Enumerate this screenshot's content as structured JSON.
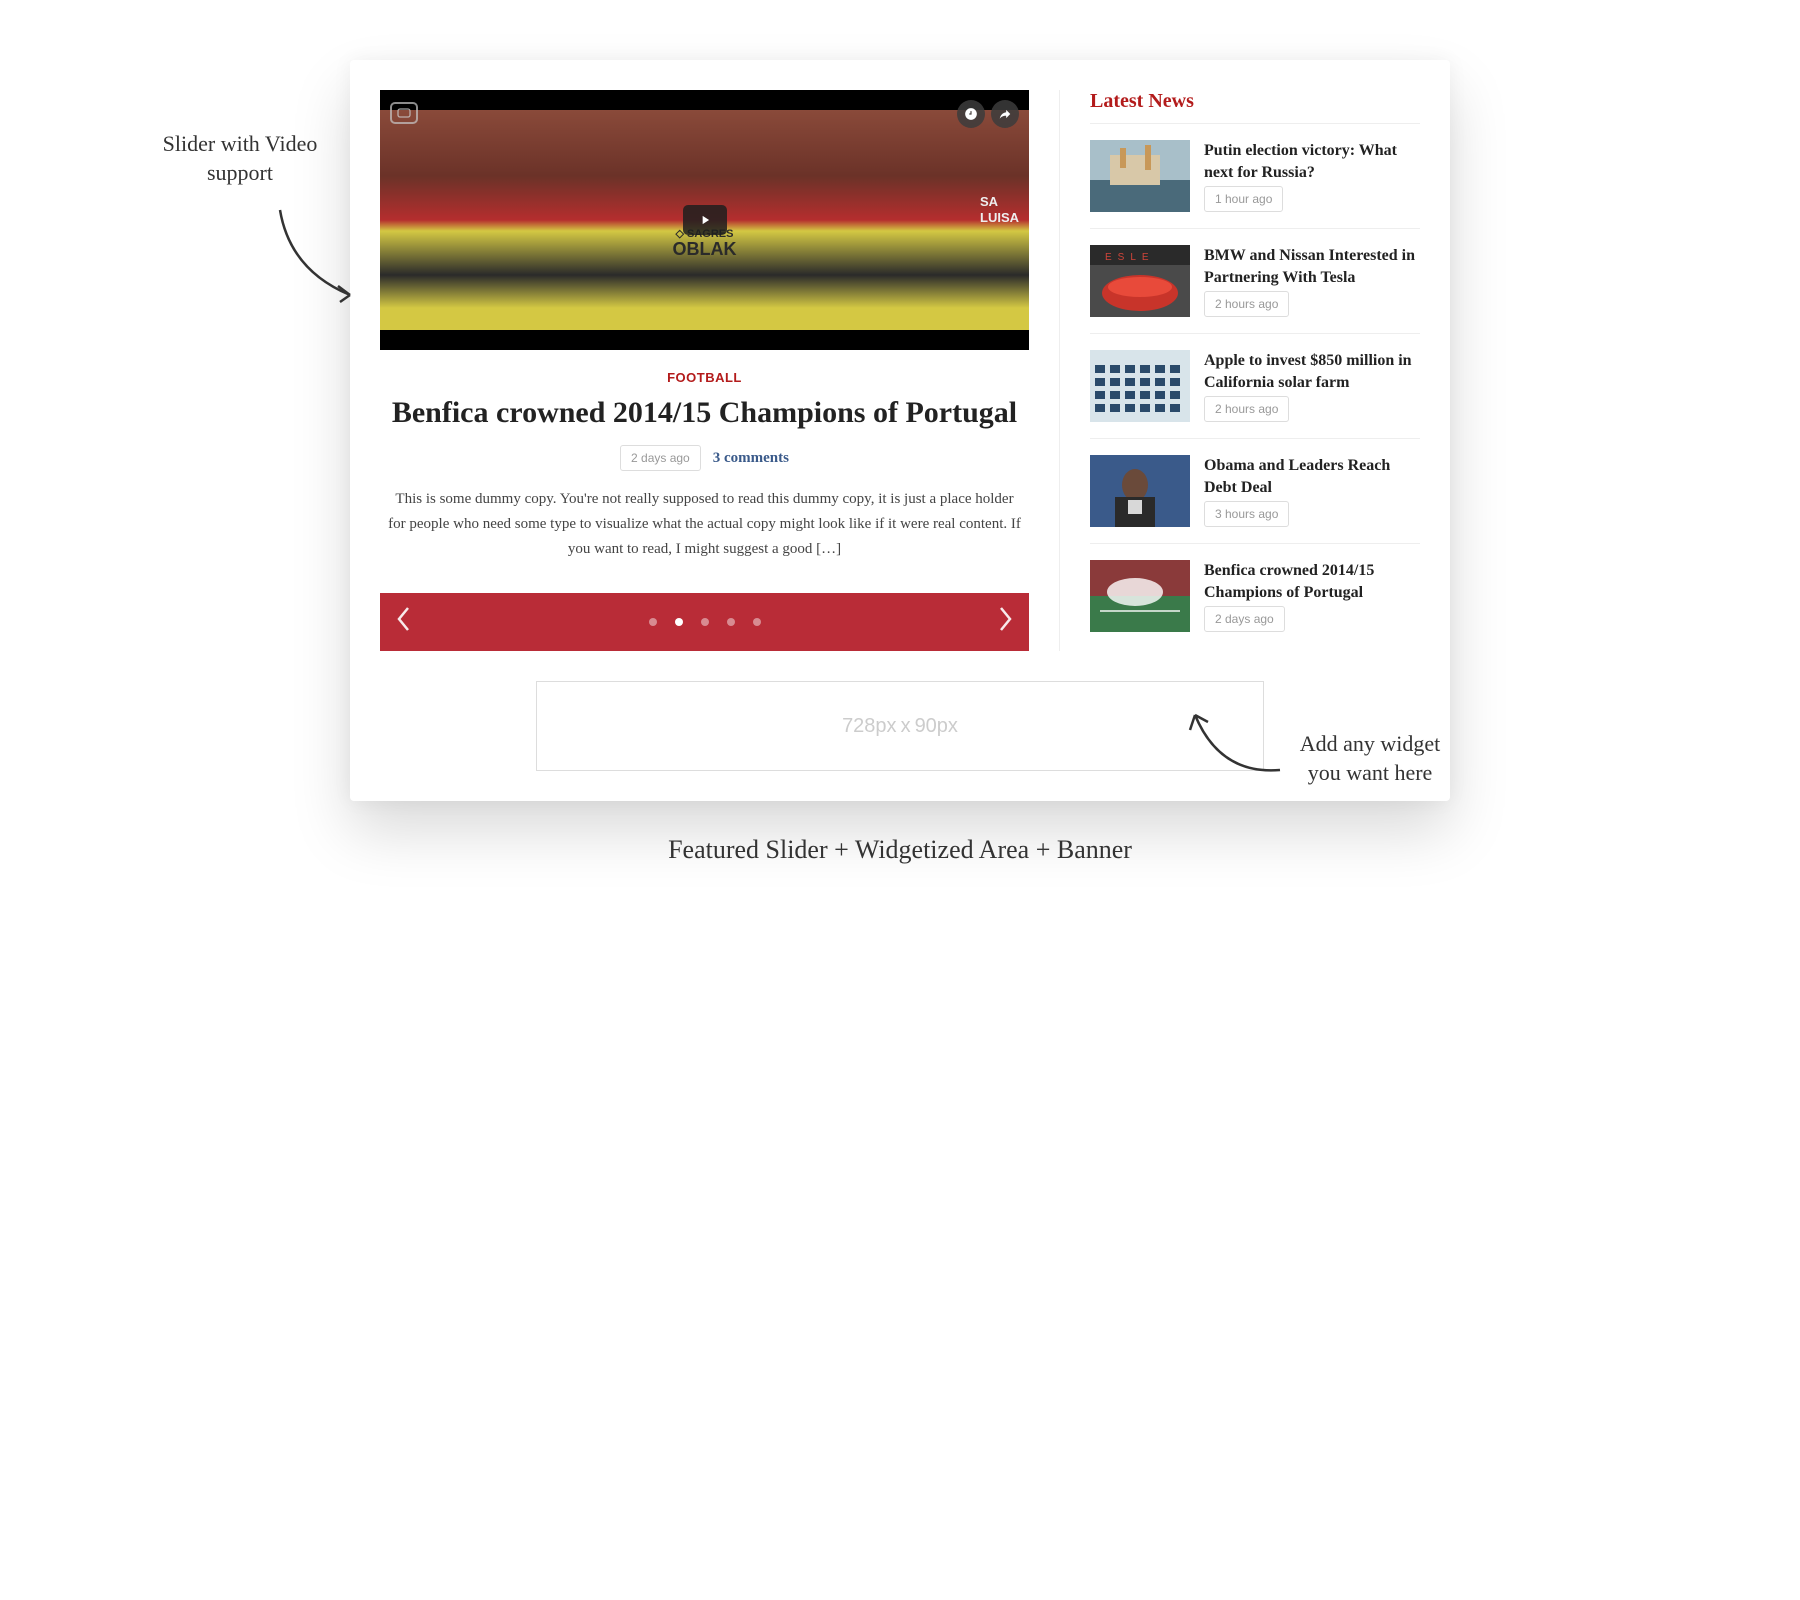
{
  "annotations": {
    "left": "Slider with Video support",
    "right": "Add any widget you want here",
    "bottom": "Featured Slider + Widgetized Area + Banner"
  },
  "slider": {
    "category": "FOOTBALL",
    "headline": "Benfica crowned 2014/15 Champions of Portugal",
    "timestamp": "2 days ago",
    "comments": "3 comments",
    "excerpt": "This is some dummy copy. You're not really supposed to read this dummy copy, it is just a place holder for people who need some type to visualize what the actual copy might look like if it were real content. If you want to read, I might suggest a good […]",
    "jersey_sponsor": "SAGRES",
    "jersey_name": "OBLAK",
    "side_text_1": "SA",
    "side_text_2": "LUISA",
    "dots_total": 5,
    "active_dot": 1
  },
  "sidebar": {
    "title": "Latest News",
    "items": [
      {
        "title": "Putin election victory: What next for Russia?",
        "time": "1 hour ago"
      },
      {
        "title": "BMW and Nissan Interested in Partnering With Tesla",
        "time": "2 hours ago"
      },
      {
        "title": "Apple to invest $850 million in California solar farm",
        "time": "2 hours ago"
      },
      {
        "title": "Obama and Leaders Reach Debt Deal",
        "time": "3 hours ago"
      },
      {
        "title": "Benfica crowned 2014/15 Champions of Portugal",
        "time": "2 days ago"
      }
    ]
  },
  "banner": {
    "width_label": "728px",
    "sep": "x",
    "height_label": "90px"
  }
}
